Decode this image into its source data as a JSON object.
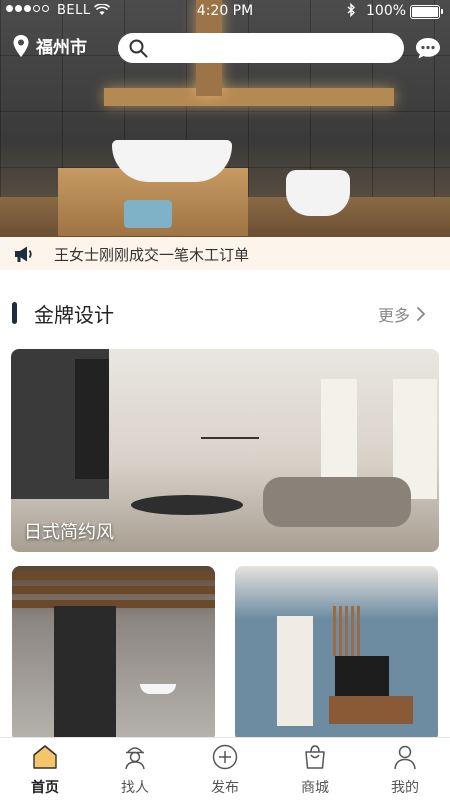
{
  "status_bar": {
    "carrier": "BELL",
    "time": "4:20 PM",
    "battery": "100%"
  },
  "header": {
    "location": "福州市",
    "search_placeholder": ""
  },
  "notice": {
    "text": "王女士刚刚成交一笔木工订单"
  },
  "section": {
    "title": "金牌设计",
    "more": "更多"
  },
  "cards": [
    {
      "caption": "日式简约风"
    }
  ],
  "tabs": [
    {
      "label": "首页",
      "icon": "home-icon",
      "active": true
    },
    {
      "label": "找人",
      "icon": "find-person-icon",
      "active": false
    },
    {
      "label": "发布",
      "icon": "publish-plus-icon",
      "active": false
    },
    {
      "label": "商城",
      "icon": "shopping-bag-icon",
      "active": false
    },
    {
      "label": "我的",
      "icon": "profile-icon",
      "active": false
    }
  ],
  "colors": {
    "accent_active_tab": "#f5c56a",
    "notice_bg": "#fdf4ec",
    "section_bar": "#1e2d3d"
  }
}
